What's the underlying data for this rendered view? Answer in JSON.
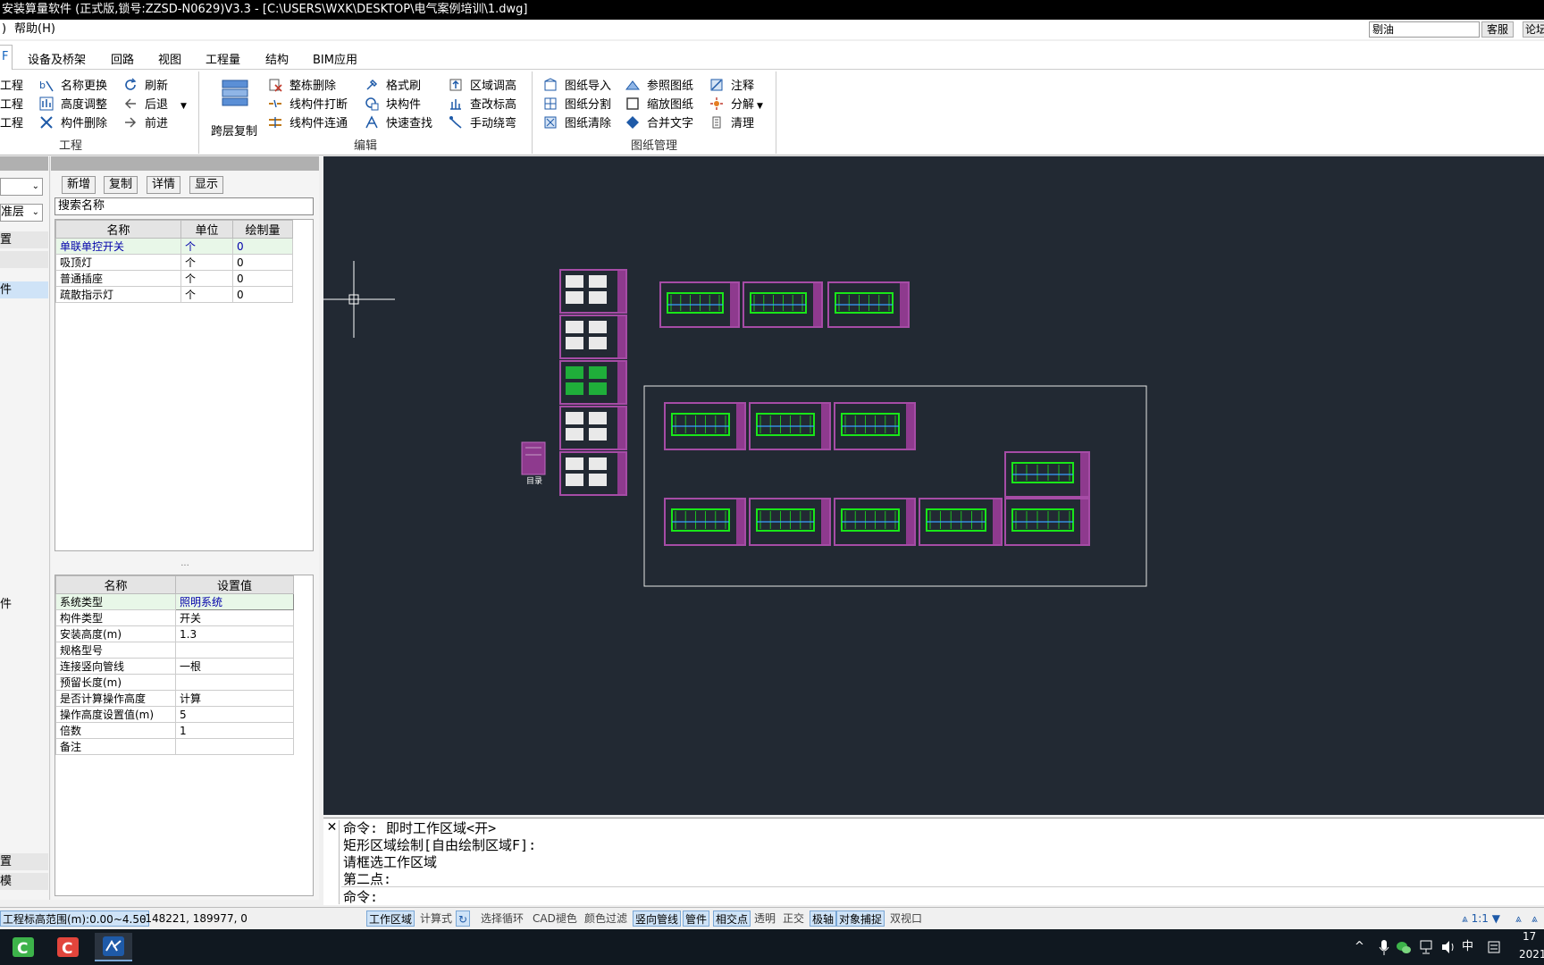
{
  "window": {
    "title": "安装算量软件 (正式版,锁号:ZZSD-N0629)V3.3 - [C:\\USERS\\WXK\\DESKTOP\\电气案例培训\\1.dwg]"
  },
  "menu": {
    "left_glyph": ")",
    "help": "帮助(H)",
    "search_value": "剔油",
    "service_btn": "客服",
    "forum_btn": "论坛"
  },
  "tabs": {
    "active": "F",
    "items": [
      "设备及桥架",
      "回路",
      "视图",
      "工程量",
      "结构",
      "BIM应用"
    ]
  },
  "ribbon": {
    "group_project": {
      "label": "工程",
      "partial": [
        "工程",
        "工程",
        "工程"
      ],
      "col2": [
        "名称更换",
        "高度调整",
        "构件删除"
      ],
      "col3": [
        "刷新",
        "后退",
        "前进"
      ]
    },
    "group_edit": {
      "label": "编辑",
      "big": "跨层复制",
      "col1": [
        "整栋删除",
        "线构件打断",
        "线构件连通"
      ],
      "col2": [
        "格式刷",
        "块构件",
        "快速查找"
      ],
      "col3": [
        "区域调高",
        "查改标高",
        "手动绕弯"
      ]
    },
    "group_drawing": {
      "label": "图纸管理",
      "col1": [
        "图纸导入",
        "图纸分割",
        "图纸清除"
      ],
      "col2": [
        "参照图纸",
        "缩放图纸",
        "合并文字"
      ],
      "col3": [
        "注释",
        "分解",
        "清理"
      ]
    }
  },
  "leftstrip": {
    "combo2": "准层",
    "rows": [
      "置",
      "",
      "件",
      "",
      "",
      "",
      "件",
      "",
      "",
      "",
      "",
      "置",
      "模"
    ]
  },
  "panel": {
    "buttons": [
      "新增",
      "复制",
      "详情",
      "显示"
    ],
    "search_value": "搜索名称",
    "list_headers": [
      "名称",
      "单位",
      "绘制量"
    ],
    "list_rows": [
      [
        "单联单控开关",
        "个",
        "0"
      ],
      [
        "吸顶灯",
        "个",
        "0"
      ],
      [
        "普通插座",
        "个",
        "0"
      ],
      [
        "疏散指示灯",
        "个",
        "0"
      ]
    ],
    "splitter": "...",
    "prop_headers": [
      "名称",
      "设置值"
    ],
    "prop_rows": [
      [
        "系统类型",
        "照明系统"
      ],
      [
        "构件类型",
        "开关"
      ],
      [
        "安装高度(m)",
        "1.3"
      ],
      [
        "规格型号",
        ""
      ],
      [
        "连接竖向管线",
        "一根"
      ],
      [
        "预留长度(m)",
        ""
      ],
      [
        "是否计算操作高度",
        "计算"
      ],
      [
        "操作高度设置值(m)",
        "5"
      ],
      [
        "倍数",
        "1"
      ],
      [
        "备注",
        ""
      ]
    ]
  },
  "canvas": {
    "mulu_label": "目录"
  },
  "command": {
    "close": "✕",
    "lines": [
      "命令: 即时工作区域<开>",
      "矩形区域绘制[自由绘制区域F]:",
      "请框选工作区域",
      "第二点:"
    ],
    "prompt": "命令:"
  },
  "status": {
    "range": "工程标高范围(m):0.00~4.50",
    "coords": "-148221, 189977, 0",
    "toggles": [
      {
        "label": "工作区域",
        "on": true
      },
      {
        "label": "计算式",
        "on": false
      },
      {
        "label": "选择循环",
        "on": false
      },
      {
        "label": "CAD褪色",
        "on": false
      },
      {
        "label": "颜色过滤",
        "on": false
      },
      {
        "label": "竖向管线",
        "on": true
      },
      {
        "label": "管件",
        "on": true
      },
      {
        "label": "相交点",
        "on": true
      },
      {
        "label": "透明",
        "on": false
      },
      {
        "label": "正交",
        "on": false
      },
      {
        "label": "极轴",
        "on": true
      },
      {
        "label": "对象捕捉",
        "on": true
      },
      {
        "label": "双视口",
        "on": false
      }
    ],
    "scale": "1:1"
  },
  "taskbar": {
    "ime": "中",
    "time": "17",
    "date": "2021"
  },
  "colors": {
    "canvas_bg": "#222933",
    "sheet_frame": "#a64ca6",
    "drawing_green": "#19e619",
    "accent": "#1565c0"
  }
}
